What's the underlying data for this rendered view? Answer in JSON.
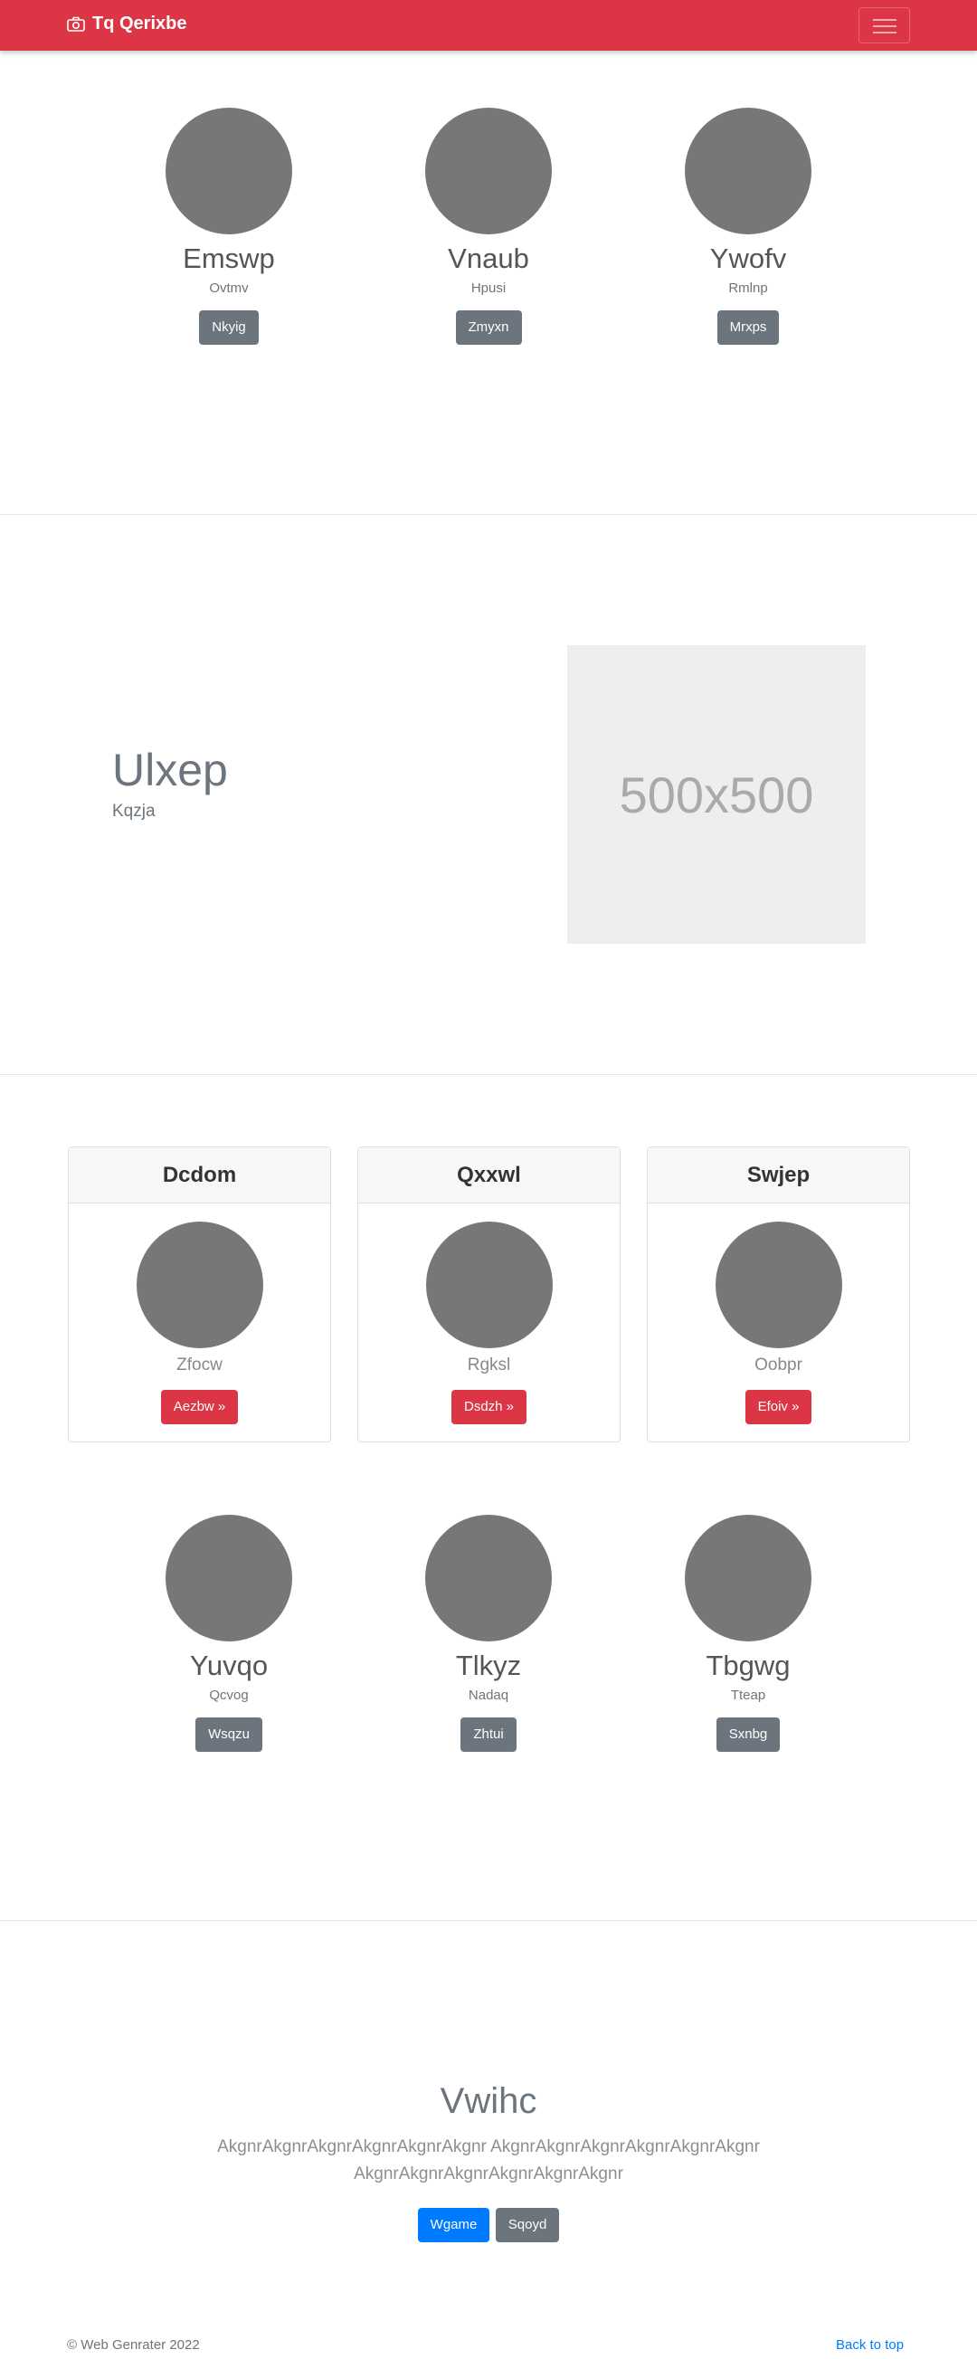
{
  "navbar": {
    "brand": "Tq Qerixbe",
    "brand_icon": "camera-icon",
    "bg": "#dc3545"
  },
  "profiles_top": [
    {
      "name": "Emswp",
      "sub": "Ovtmv",
      "button": "Nkyig"
    },
    {
      "name": "Vnaub",
      "sub": "Hpusi",
      "button": "Zmyxn"
    },
    {
      "name": "Ywofv",
      "sub": "Rmlnp",
      "button": "Mrxps"
    }
  ],
  "feature": {
    "title": "Ulxep",
    "subtitle": "Kqzja",
    "placeholder": "500x500"
  },
  "cards": [
    {
      "header": "Dcdom",
      "sub": "Zfocw",
      "button": "Aezbw »"
    },
    {
      "header": "Qxxwl",
      "sub": "Rgksl",
      "button": "Dsdzh »"
    },
    {
      "header": "Swjep",
      "sub": "Oobpr",
      "button": "Efoiv »"
    }
  ],
  "profiles_bottom": [
    {
      "name": "Yuvqo",
      "sub": "Qcvog",
      "button": "Wsqzu"
    },
    {
      "name": "Tlkyz",
      "sub": "Nadaq",
      "button": "Zhtui"
    },
    {
      "name": "Tbgwg",
      "sub": "Tteap",
      "button": "Sxnbg"
    }
  ],
  "hero": {
    "title": "Vwihc",
    "text": "AkgnrAkgnrAkgnrAkgnrAkgnrAkgnr AkgnrAkgnrAkgnrAkgnrAkgnrAkgnr AkgnrAkgnrAkgnrAkgnrAkgnrAkgnr",
    "primary_button": "Wgame",
    "secondary_button": "Sqoyd"
  },
  "footer": {
    "copyright": "© Web Genrater 2022",
    "back_to_top": "Back to top"
  }
}
